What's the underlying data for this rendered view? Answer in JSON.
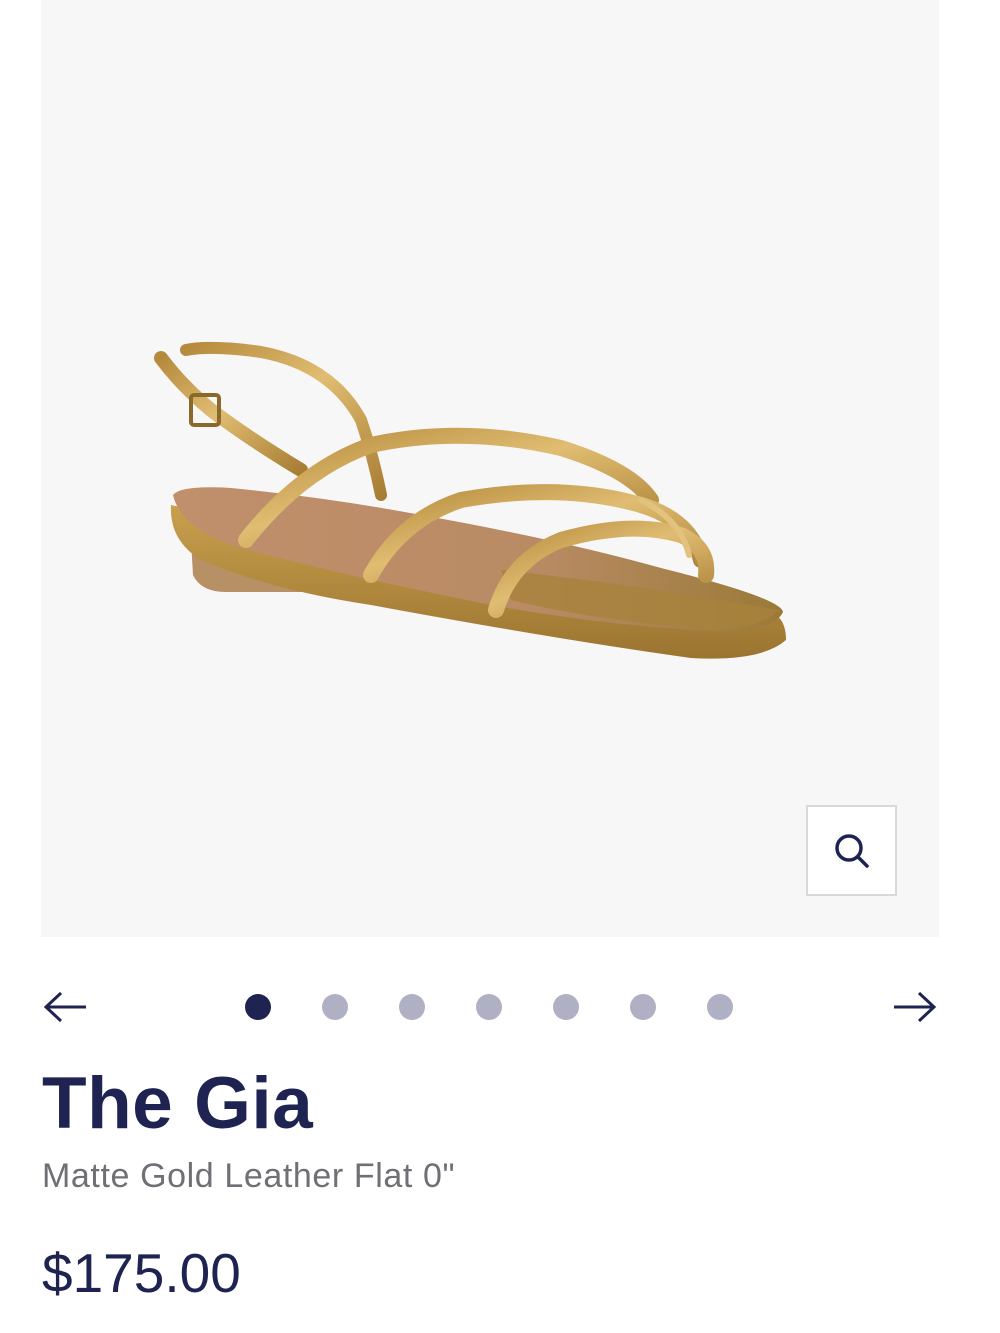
{
  "gallery": {
    "image_alt": "Gold strappy flat sandal",
    "zoom_icon": "search-icon",
    "prev_icon": "arrow-left-icon",
    "next_icon": "arrow-right-icon",
    "slide_count": 7,
    "active_slide": 1
  },
  "product": {
    "title": "The Gia",
    "subtitle": "Matte Gold Leather Flat 0\"",
    "price": "$175.00"
  },
  "colors": {
    "brand_navy": "#1e2352",
    "dot_inactive": "#b0b0c4",
    "gallery_bg": "#f7f7f7",
    "sandal_gold": "#c9a04e"
  }
}
